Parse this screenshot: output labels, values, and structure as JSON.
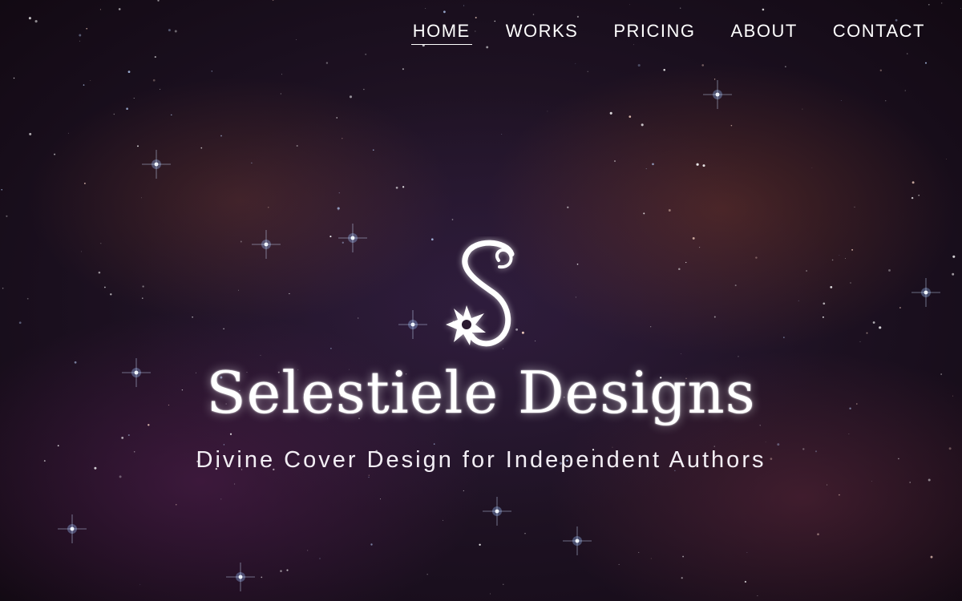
{
  "nav": {
    "items": [
      {
        "label": "HOME",
        "active": true
      },
      {
        "label": "WORKS",
        "active": false
      },
      {
        "label": "PRICING",
        "active": false
      },
      {
        "label": "ABOUT",
        "active": false
      },
      {
        "label": "CONTACT",
        "active": false
      }
    ]
  },
  "hero": {
    "brand_name": "Selestiele Designs",
    "tagline": "Divine Cover Design for Independent Authors",
    "logo_icon": "s-monogram-flower-icon",
    "background": "starry-nebula-image"
  },
  "colors": {
    "text": "#ffffff",
    "background": "#1a0f1e"
  }
}
